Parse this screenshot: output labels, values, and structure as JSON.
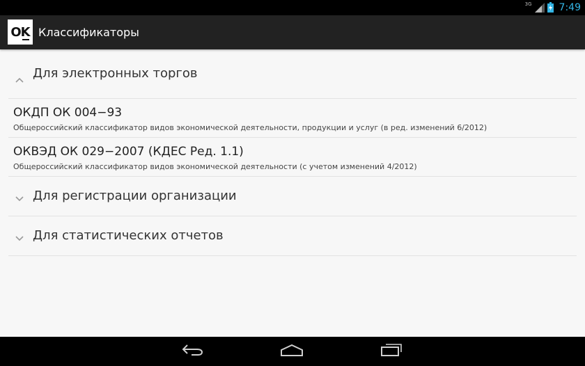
{
  "status_bar": {
    "network": "3G",
    "time": "7:49"
  },
  "action_bar": {
    "app_icon_text": "OK",
    "title": "Классификаторы"
  },
  "groups": [
    {
      "label": "Для электронных торгов",
      "expanded": true,
      "items": [
        {
          "title": "ОКДП ОК 004−93",
          "subtitle": "Общероссийский классификатор видов экономической деятельности, продукции и услуг (в ред. изменений 6/2012)"
        },
        {
          "title": "ОКВЭД ОК 029−2007 (КДЕС Ред. 1.1)",
          "subtitle": "Общероссийский классификатор видов экономической деятельности (с учетом изменений 4/2012)"
        }
      ]
    },
    {
      "label": "Для регистрации организации",
      "expanded": false
    },
    {
      "label": "Для статистических отчетов",
      "expanded": false
    }
  ],
  "colors": {
    "status_bar": "#000000",
    "action_bar": "#222222",
    "clock": "#33b5e5",
    "background": "#f7f7f7",
    "divider": "#e2e2e2"
  },
  "icons": {
    "nav": [
      "back-icon",
      "home-icon",
      "recent-apps-icon"
    ],
    "status": [
      "signal-icon",
      "battery-icon"
    ]
  }
}
